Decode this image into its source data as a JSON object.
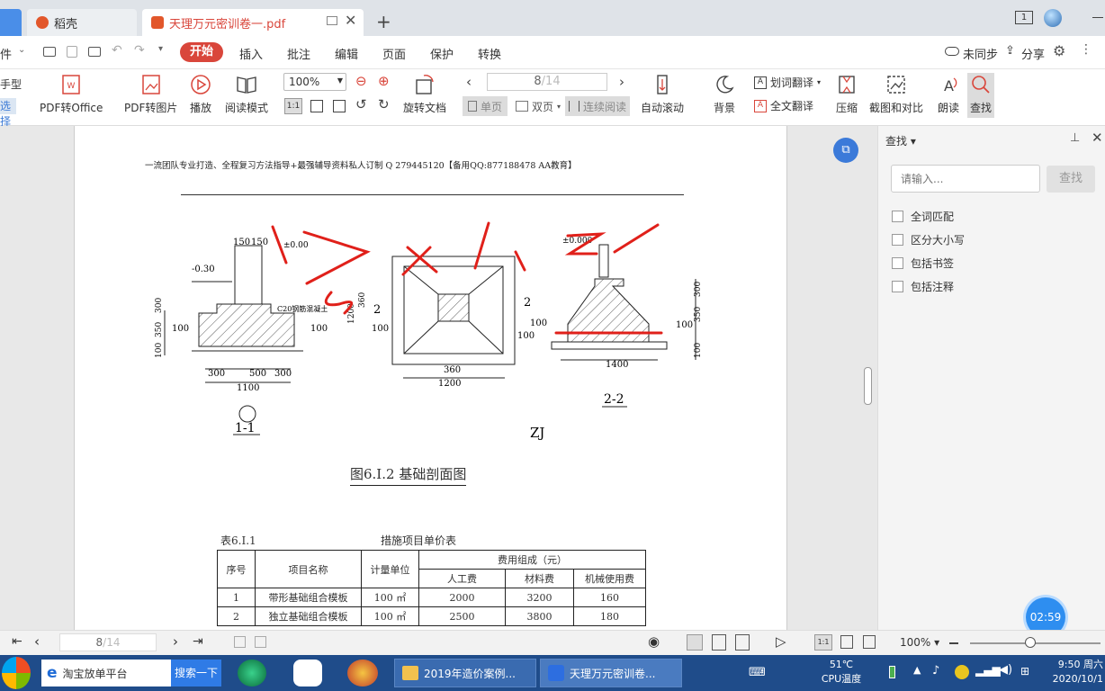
{
  "tabs": [
    {
      "label": "稻壳"
    },
    {
      "label": "天理万元密训卷一.pdf"
    }
  ],
  "window_badge": "1",
  "menu": {
    "file_label": "件",
    "start": "开始",
    "items": [
      "插入",
      "批注",
      "编辑",
      "页面",
      "保护",
      "转换"
    ],
    "sync": "未同步",
    "share": "分享"
  },
  "toolbar": {
    "left_cut_1": "手型",
    "left_cut_2": "选择",
    "pdf_office": "PDF转Office",
    "pdf_image": "PDF转图片",
    "play": "播放",
    "read_mode": "阅读模式",
    "zoom": "100%",
    "rotate": "旋转文档",
    "page_current": "8",
    "page_total": "/14",
    "single": "单页",
    "double": "双页",
    "continuous": "连续阅读",
    "auto_scroll": "自动滚动",
    "background": "背景",
    "word_translate": "划词翻译",
    "full_translate": "全文翻译",
    "compress": "压缩",
    "screenshot_compare": "截图和对比",
    "read_aloud": "朗读",
    "find": "查找"
  },
  "document": {
    "header_line": "一流团队专业打造、全程复习方法指导+最强辅导资料私人订制 Q 279445120【备用QQ:877188478 AA教育】",
    "figure_caption": "图6.Ⅰ.2 基础剖面图",
    "section_11": "1-1",
    "section_zj": "ZJ",
    "section_22": "2-2",
    "table_no": "表6.Ⅰ.1",
    "table_title": "措施项目单价表",
    "table": {
      "h_seq": "序号",
      "h_name": "项目名称",
      "h_unit": "计量单位",
      "h_group": "费用组成（元）",
      "h_labor": "人工费",
      "h_material": "材料费",
      "h_machine": "机械使用费",
      "rows": [
        {
          "seq": "1",
          "name": "带形基础组合模板",
          "unit": "100 ㎡",
          "labor": "2000",
          "material": "3200",
          "machine": "160"
        },
        {
          "seq": "2",
          "name": "独立基础组合模板",
          "unit": "100 ㎡",
          "labor": "2500",
          "material": "3800",
          "machine": "180"
        }
      ]
    },
    "dims_11": [
      "150",
      "150",
      "±0.00",
      "-0.30",
      "C20钢筋混凝土",
      "300",
      "350",
      "100",
      "100",
      "100",
      "300",
      "500",
      "300",
      "1100"
    ],
    "dims_zj": [
      "1200",
      "360",
      "360",
      "1200",
      "100",
      "100",
      "2"
    ],
    "dims_22": [
      "±0.000",
      "300",
      "350",
      "100",
      "100",
      "100",
      "1400",
      "2"
    ]
  },
  "side_panel": {
    "title": "查找",
    "placeholder": "请输入...",
    "find_button": "查找",
    "options": [
      "全词匹配",
      "区分大小写",
      "包括书签",
      "包括注释"
    ]
  },
  "timer": "02:59",
  "status": {
    "page_current": "8",
    "page_total": "/14",
    "zoom": "100%"
  },
  "taskbar": {
    "browser_label": "淘宝放单平台",
    "search_btn": "搜索一下",
    "win1": "2019年造价案例...",
    "win2": "天理万元密训卷...",
    "temp": "51℃",
    "temp_label": "CPU温度",
    "time": "9:50 周六",
    "date": "2020/10/1"
  },
  "colors": {
    "accent": "#d9463b",
    "annotation_red": "#e0201a",
    "taskbar": "#1f4c8a"
  }
}
